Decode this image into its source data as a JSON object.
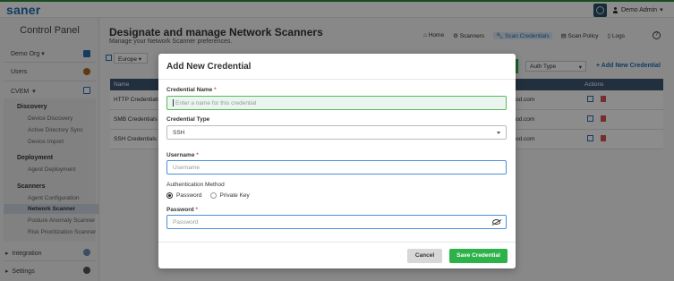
{
  "app": {
    "logo": "saner",
    "user": "Demo Admin"
  },
  "sidebar": {
    "title": "Control Panel",
    "org": "Demo Org",
    "users": "Users",
    "product": "CVEM",
    "discovery": {
      "head": "Discovery",
      "items": [
        "Device Discovery",
        "Active Directory Sync",
        "Device Import"
      ]
    },
    "deployment": {
      "head": "Deployment",
      "items": [
        "Agent Deployment"
      ]
    },
    "scanners": {
      "head": "Scanners",
      "items": [
        "Agent Configuration",
        "Network Scanner",
        "Posture Anomaly Scanner",
        "Risk Prioritization Scanner"
      ]
    },
    "integration": "Integration",
    "settings": "Settings"
  },
  "main": {
    "title": "Designate and manage Network Scanners",
    "subtitle": "Manage your Network Scanner preferences.",
    "nav": [
      "Home",
      "Scanners",
      "Scan Credentials",
      "Scan Policy",
      "Logs"
    ],
    "region": "Europe",
    "auth_type_placeholder": "Auth Type",
    "add_new": "+ Add New Credential",
    "table": {
      "headers": [
        "Name",
        "Actions"
      ],
      "rows": [
        {
          "name": "HTTP Credentials",
          "owner": "od.com"
        },
        {
          "name": "SMB Credentials",
          "owner": "od.com"
        },
        {
          "name": "SSH Credentials",
          "owner": "od.com"
        }
      ]
    }
  },
  "modal": {
    "title": "Add New Credential",
    "name_label": "Credential Name",
    "name_placeholder": "Enter a name for this credential",
    "type_label": "Credential Type",
    "type_value": "SSH",
    "username_label": "Username",
    "username_placeholder": "Username",
    "auth_label": "Authentication Method",
    "auth_options": [
      "Password",
      "Private Key"
    ],
    "password_label": "Password",
    "password_placeholder": "Password",
    "required_mark": "*",
    "cancel": "Cancel",
    "save": "Save Credential"
  }
}
